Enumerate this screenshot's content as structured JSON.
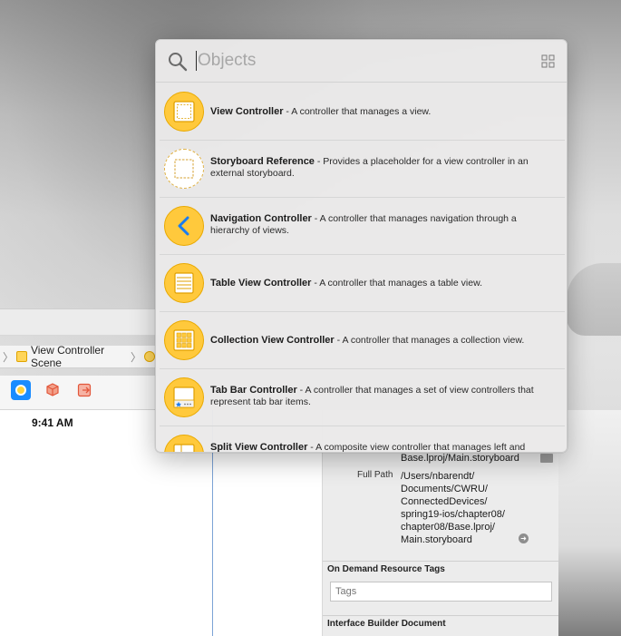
{
  "library": {
    "search_placeholder": "Objects",
    "search_icon": "magnifying-glass-icon",
    "view_toggle_icon": "grid-view-icon",
    "separator": " - ",
    "items": [
      {
        "name": "View Controller",
        "description": "A controller that manages a view.",
        "icon": "view-controller-icon"
      },
      {
        "name": "Storyboard Reference",
        "description": "Provides a placeholder for a view controller in an external storyboard.",
        "icon": "storyboard-reference-icon"
      },
      {
        "name": "Navigation Controller",
        "description": "A controller that manages navigation through a hierarchy of views.",
        "icon": "navigation-controller-icon"
      },
      {
        "name": "Table View Controller",
        "description": "A controller that manages a table view.",
        "icon": "table-view-controller-icon"
      },
      {
        "name": "Collection View Controller",
        "description": "A controller that manages a collection view.",
        "icon": "collection-view-controller-icon"
      },
      {
        "name": "Tab Bar Controller",
        "description": "A controller that manages a set of view controllers that represent tab bar items.",
        "icon": "tab-bar-controller-icon"
      },
      {
        "name": "Split View Controller",
        "description": "A composite view controller that manages left and",
        "icon": "split-view-controller-icon"
      }
    ]
  },
  "jumpbar": {
    "scene_label": "View Controller Scene"
  },
  "canvas": {
    "status_time": "9:41 AM"
  },
  "inspector": {
    "location_value": "Base.lproj/Main.storyboard",
    "full_path_label": "Full Path",
    "full_path_lines": [
      "/Users/nbarendt/",
      "Documents/CWRU/",
      "ConnectedDevices/",
      "spring19-ios/chapter08/",
      "chapter08/Base.lproj/",
      "Main.storyboard"
    ],
    "on_demand_title": "On Demand Resource Tags",
    "tags_placeholder": "Tags",
    "ib_document_title": "Interface Builder Document"
  },
  "colors": {
    "accent_yellow": "#ffc93c",
    "accent_blue": "#1a8cff",
    "popover_bg": "#eae9e9"
  }
}
